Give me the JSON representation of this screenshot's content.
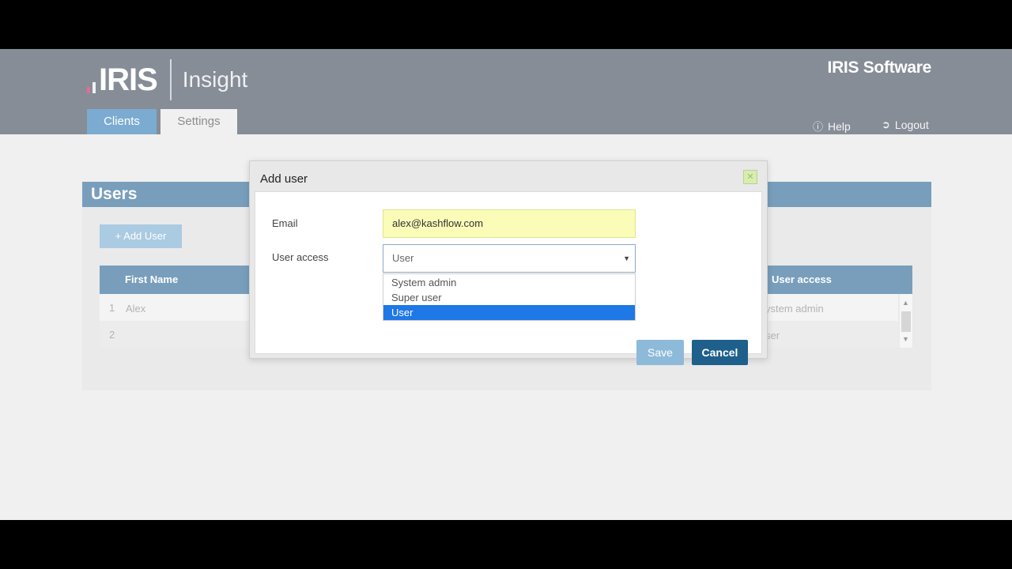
{
  "header": {
    "logo_text": "IRIS",
    "product": "Insight",
    "company": "IRIS Software",
    "tabs": [
      {
        "label": "Clients",
        "active": true
      },
      {
        "label": "Settings",
        "active": false
      }
    ],
    "help_label": "Help",
    "logout_label": "Logout",
    "logo_bar_colors": [
      "#e03a72",
      "#e8edf2",
      "#e8edf2"
    ]
  },
  "users_page": {
    "title": "Users",
    "add_user_label": "+ Add User",
    "columns": [
      "First Name",
      "User access"
    ],
    "rows": [
      {
        "index": "1",
        "first_name": "Alex",
        "access": "ystem admin"
      },
      {
        "index": "2",
        "first_name": "",
        "access": "ser"
      }
    ]
  },
  "modal": {
    "title": "Add user",
    "email_label": "Email",
    "email_value": "alex@kashflow.com",
    "access_label": "User access",
    "access_selected": "User",
    "options": [
      "System admin",
      "Super user",
      "User"
    ],
    "highlighted_option": "User",
    "save_label": "Save",
    "cancel_label": "Cancel"
  },
  "icons": {
    "help": "question-circle-icon",
    "logout": "sign-out-icon",
    "close": "close-icon",
    "dropdown": "caret-down-icon"
  },
  "colors": {
    "header_bg": "#5e6774",
    "accent": "#4b7ea6",
    "highlight": "#1e78e6",
    "email_field_bg": "#fafcb8"
  }
}
